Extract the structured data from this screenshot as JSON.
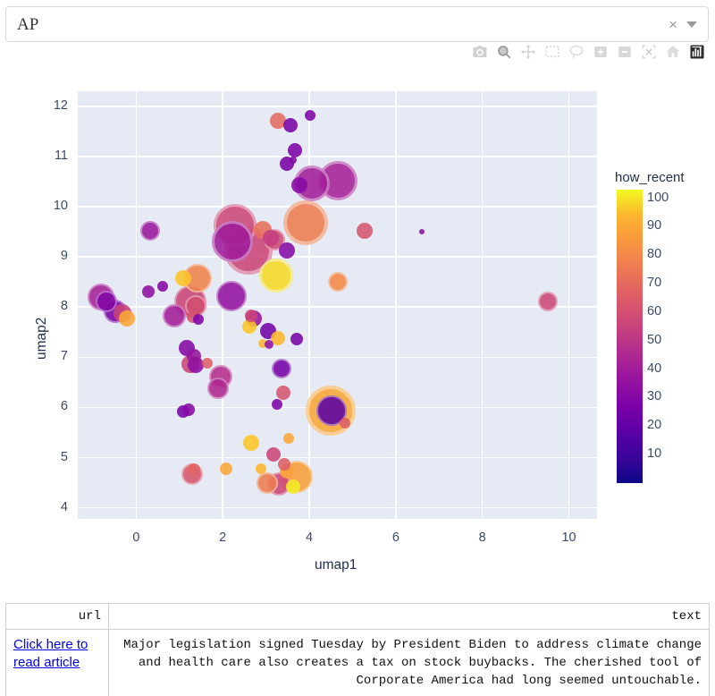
{
  "selector": {
    "value": "AP",
    "clear_label": "×",
    "caret": "dropdown-caret"
  },
  "modebar": {
    "buttons": [
      {
        "name": "download-plot-icon",
        "title": "Download plot as a png"
      },
      {
        "name": "zoom-icon",
        "title": "Zoom"
      },
      {
        "name": "pan-icon",
        "title": "Pan"
      },
      {
        "name": "box-select-icon",
        "title": "Box Select"
      },
      {
        "name": "lasso-select-icon",
        "title": "Lasso Select"
      },
      {
        "name": "zoom-in-icon",
        "title": "Zoom in"
      },
      {
        "name": "zoom-out-icon",
        "title": "Zoom out"
      },
      {
        "name": "autoscale-icon",
        "title": "Autoscale"
      },
      {
        "name": "reset-axes-icon",
        "title": "Reset axes"
      },
      {
        "name": "plotly-logo-icon",
        "title": "Produced with Plotly"
      }
    ]
  },
  "chart_data": {
    "type": "scatter",
    "title": "",
    "xlabel": "umap1",
    "ylabel": "umap2",
    "xlim": [
      -1.35,
      10.65
    ],
    "ylim": [
      3.78,
      12.3
    ],
    "xticks": [
      0,
      2,
      4,
      6,
      8,
      10
    ],
    "yticks": [
      4,
      5,
      6,
      7,
      8,
      9,
      10,
      11,
      12
    ],
    "grid": true,
    "plot_bgcolor": "#E5EAF4",
    "gridcolor": "#FFFFFF",
    "colorbar": {
      "title": "how_recent",
      "colorscale": "Plasma",
      "ticks": [
        10,
        20,
        30,
        40,
        50,
        60,
        70,
        80,
        90,
        100
      ],
      "cmin": 0,
      "cmax": 103,
      "position": "right"
    },
    "size_encoding": "marker size varies by article count",
    "points": [
      {
        "x": 3.28,
        "y": 11.72,
        "size": 9,
        "c": 62
      },
      {
        "x": 4.02,
        "y": 11.82,
        "size": 6,
        "c": 26
      },
      {
        "x": 3.56,
        "y": 11.62,
        "size": 8,
        "c": 24
      },
      {
        "x": 3.66,
        "y": 11.12,
        "size": 8,
        "c": 25
      },
      {
        "x": 3.62,
        "y": 10.92,
        "size": 4,
        "c": 27
      },
      {
        "x": 3.48,
        "y": 10.86,
        "size": 8,
        "c": 24
      },
      {
        "x": 4.06,
        "y": 10.46,
        "size": 20,
        "c": 36
      },
      {
        "x": 3.78,
        "y": 10.42,
        "size": 9,
        "c": 28
      },
      {
        "x": 4.66,
        "y": 10.52,
        "size": 22,
        "c": 37
      },
      {
        "x": 0.32,
        "y": 9.52,
        "size": 11,
        "c": 33
      },
      {
        "x": 2.28,
        "y": 9.62,
        "size": 24,
        "c": 51
      },
      {
        "x": 2.22,
        "y": 9.3,
        "size": 23,
        "c": 35
      },
      {
        "x": 2.6,
        "y": 9.12,
        "size": 27,
        "c": 50
      },
      {
        "x": 2.92,
        "y": 9.54,
        "size": 10,
        "c": 64
      },
      {
        "x": 3.2,
        "y": 9.34,
        "size": 12,
        "c": 52
      },
      {
        "x": 3.12,
        "y": 9.38,
        "size": 9,
        "c": 47
      },
      {
        "x": 3.92,
        "y": 9.68,
        "size": 25,
        "c": 68
      },
      {
        "x": 3.48,
        "y": 9.12,
        "size": 9,
        "c": 28
      },
      {
        "x": 5.28,
        "y": 9.52,
        "size": 9,
        "c": 55
      },
      {
        "x": 6.6,
        "y": 9.5,
        "size": 3,
        "c": 30
      },
      {
        "x": 3.24,
        "y": 8.62,
        "size": 19,
        "c": 93
      },
      {
        "x": 4.66,
        "y": 8.5,
        "size": 11,
        "c": 72
      },
      {
        "x": 1.08,
        "y": 8.58,
        "size": 9,
        "c": 88
      },
      {
        "x": 1.42,
        "y": 8.58,
        "size": 16,
        "c": 70
      },
      {
        "x": 9.52,
        "y": 8.12,
        "size": 11,
        "c": 51
      },
      {
        "x": 0.62,
        "y": 8.42,
        "size": 6,
        "c": 27
      },
      {
        "x": -0.82,
        "y": 8.2,
        "size": 15,
        "c": 37
      },
      {
        "x": -0.68,
        "y": 8.12,
        "size": 12,
        "c": 27
      },
      {
        "x": 0.28,
        "y": 8.3,
        "size": 7,
        "c": 30
      },
      {
        "x": -0.48,
        "y": 7.92,
        "size": 13,
        "c": 24
      },
      {
        "x": -0.32,
        "y": 7.88,
        "size": 10,
        "c": 50
      },
      {
        "x": -0.22,
        "y": 7.78,
        "size": 9,
        "c": 80
      },
      {
        "x": 2.2,
        "y": 8.22,
        "size": 17,
        "c": 31
      },
      {
        "x": 1.26,
        "y": 8.12,
        "size": 18,
        "c": 50
      },
      {
        "x": 1.38,
        "y": 8.02,
        "size": 12,
        "c": 53
      },
      {
        "x": 0.88,
        "y": 7.82,
        "size": 13,
        "c": 36
      },
      {
        "x": 2.72,
        "y": 7.78,
        "size": 9,
        "c": 32
      },
      {
        "x": 2.66,
        "y": 7.82,
        "size": 7,
        "c": 50
      },
      {
        "x": 2.62,
        "y": 7.62,
        "size": 8,
        "c": 88
      },
      {
        "x": 1.32,
        "y": 7.8,
        "size": 7,
        "c": 54
      },
      {
        "x": 1.44,
        "y": 7.76,
        "size": 6,
        "c": 26
      },
      {
        "x": 3.04,
        "y": 7.52,
        "size": 9,
        "c": 22
      },
      {
        "x": 3.72,
        "y": 7.36,
        "size": 7,
        "c": 24
      },
      {
        "x": 3.28,
        "y": 7.38,
        "size": 8,
        "c": 84
      },
      {
        "x": 2.92,
        "y": 7.28,
        "size": 5,
        "c": 84
      },
      {
        "x": 3.06,
        "y": 7.26,
        "size": 5,
        "c": 31
      },
      {
        "x": 1.18,
        "y": 7.18,
        "size": 9,
        "c": 27
      },
      {
        "x": 1.34,
        "y": 7.02,
        "size": 8,
        "c": 32
      },
      {
        "x": 1.26,
        "y": 6.86,
        "size": 10,
        "c": 50
      },
      {
        "x": 1.38,
        "y": 6.84,
        "size": 9,
        "c": 30
      },
      {
        "x": 1.64,
        "y": 6.88,
        "size": 6,
        "c": 58
      },
      {
        "x": 3.36,
        "y": 6.78,
        "size": 11,
        "c": 23
      },
      {
        "x": 1.96,
        "y": 6.62,
        "size": 13,
        "c": 42
      },
      {
        "x": 1.9,
        "y": 6.38,
        "size": 12,
        "c": 40
      },
      {
        "x": 3.4,
        "y": 6.3,
        "size": 8,
        "c": 55
      },
      {
        "x": 3.26,
        "y": 6.06,
        "size": 6,
        "c": 26
      },
      {
        "x": 1.08,
        "y": 5.92,
        "size": 7,
        "c": 24
      },
      {
        "x": 1.22,
        "y": 5.96,
        "size": 7,
        "c": 28
      },
      {
        "x": 4.5,
        "y": 5.94,
        "size": 28,
        "c": 80
      },
      {
        "x": 4.52,
        "y": 5.94,
        "size": 17,
        "c": 17
      },
      {
        "x": 4.82,
        "y": 5.68,
        "size": 6,
        "c": 58
      },
      {
        "x": 2.66,
        "y": 5.3,
        "size": 9,
        "c": 88
      },
      {
        "x": 3.52,
        "y": 5.38,
        "size": 6,
        "c": 80
      },
      {
        "x": 3.18,
        "y": 5.06,
        "size": 8,
        "c": 50
      },
      {
        "x": 1.3,
        "y": 4.68,
        "size": 12,
        "c": 56
      },
      {
        "x": 1.34,
        "y": 4.76,
        "size": 7,
        "c": 60
      },
      {
        "x": 2.08,
        "y": 4.78,
        "size": 7,
        "c": 80
      },
      {
        "x": 2.88,
        "y": 4.78,
        "size": 6,
        "c": 84
      },
      {
        "x": 3.48,
        "y": 4.72,
        "size": 8,
        "c": 78
      },
      {
        "x": 3.42,
        "y": 4.86,
        "size": 7,
        "c": 58
      },
      {
        "x": 3.7,
        "y": 4.62,
        "size": 18,
        "c": 78
      },
      {
        "x": 3.02,
        "y": 4.5,
        "size": 12,
        "c": 68
      },
      {
        "x": 3.3,
        "y": 4.48,
        "size": 13,
        "c": 50
      },
      {
        "x": 3.62,
        "y": 4.42,
        "size": 8,
        "c": 97
      }
    ]
  },
  "table": {
    "columns": [
      "url",
      "text"
    ],
    "rows": [
      {
        "url_label": "Click here to read article",
        "text": "Major legislation signed Tuesday by President Biden to address climate change and health care also creates a tax on stock buybacks. The cherished tool of Corporate America had long seemed untouchable."
      }
    ]
  }
}
